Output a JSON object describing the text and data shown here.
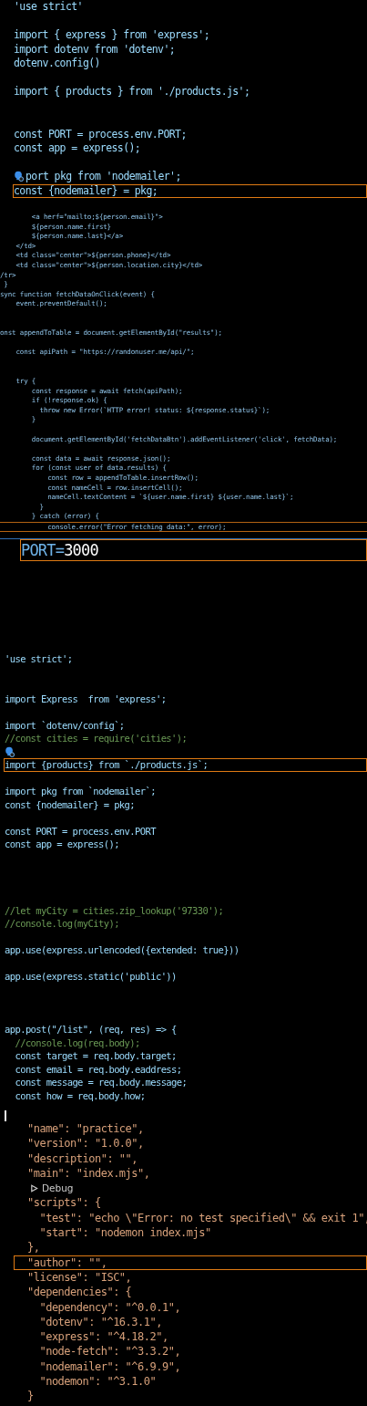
{
  "panels": [
    {
      "kind": "js",
      "lines": [
        {
          "text": "'use strict'",
          "kind": "code",
          "current": false
        },
        {
          "kind": "blank",
          "current": false
        },
        {
          "text": "import { express } from 'express';",
          "kind": "code",
          "current": false
        },
        {
          "text": "import dotenv from 'dotenv';",
          "kind": "code",
          "current": false
        },
        {
          "text": "dotenv.config()",
          "kind": "code",
          "current": false
        },
        {
          "kind": "blank",
          "current": false
        },
        {
          "text": "import { products } from './products.js';",
          "kind": "code",
          "current": false
        },
        {
          "kind": "blank",
          "current": false
        },
        {
          "kind": "blank",
          "current": false
        },
        {
          "text": "const PORT = process.env.PORT;",
          "kind": "code",
          "current": false
        },
        {
          "text": "const app = express();",
          "kind": "code",
          "current": false
        },
        {
          "kind": "blank",
          "current": false
        },
        {
          "text": "port pkg from 'nodemailer';",
          "kind": "hint",
          "current": false
        },
        {
          "text": "const {nodemailer} = pkg;",
          "kind": "code",
          "current": true
        }
      ]
    },
    {
      "kind": "js-small",
      "lines": [
        {
          "text": "        <a herf=\"mailto;${person.email}\">",
          "kind": "code",
          "current": false
        },
        {
          "text": "        ${person.name.first}",
          "kind": "code",
          "current": false
        },
        {
          "text": "        ${person.name.last}</a>",
          "kind": "code",
          "current": false
        },
        {
          "text": "    </td>",
          "kind": "code",
          "current": false
        },
        {
          "text": "    <td class=\"center\">${person.phone}</td>",
          "kind": "code",
          "current": false
        },
        {
          "text": "    <td class=\"center\">${person.location.city}</td>",
          "kind": "code",
          "current": false
        },
        {
          "text": "/tr>",
          "kind": "code",
          "current": false
        },
        {
          "text": " }",
          "kind": "code",
          "current": false
        },
        {
          "text": "sync function fetchDataOnClick(event) {",
          "kind": "code",
          "current": false
        },
        {
          "text": "    event.preventDefault();",
          "kind": "code",
          "current": false
        },
        {
          "kind": "blank",
          "current": false
        },
        {
          "kind": "blank",
          "current": false
        },
        {
          "text": "onst appendToTable = document.getElementById(\"results\");",
          "kind": "code",
          "current": false
        },
        {
          "kind": "blank",
          "current": false
        },
        {
          "text": "    const apiPath = \"https://randonuser.me/api/\";",
          "kind": "code",
          "current": false
        },
        {
          "kind": "blank",
          "current": false
        },
        {
          "kind": "blank",
          "current": false
        },
        {
          "text": "    try {",
          "kind": "code",
          "current": false
        },
        {
          "text": "        const response = await fetch(apiPath);",
          "kind": "code",
          "current": false
        },
        {
          "text": "        if (!response.ok) {",
          "kind": "code",
          "current": false
        },
        {
          "text": "          throw new Error(`HTTP error! status: ${response.status}`);",
          "kind": "code",
          "current": false
        },
        {
          "text": "        }",
          "kind": "code",
          "current": false
        },
        {
          "kind": "blank",
          "current": false
        },
        {
          "text": "        document.getElementById('fetchDataBtn').addEventListener('click', fetchData);",
          "kind": "code",
          "current": false
        },
        {
          "kind": "blank",
          "current": false
        },
        {
          "text": "        const data = await response.json();",
          "kind": "code",
          "current": false
        },
        {
          "text": "        for (const user of data.results) {",
          "kind": "code",
          "current": false
        },
        {
          "text": "            const row = appendToTable.insertRow();",
          "kind": "code",
          "current": false
        },
        {
          "text": "            const nameCell = row.insertCell();",
          "kind": "code",
          "current": false
        },
        {
          "text": "            nameCell.textContent = `${user.name.first} ${user.name.last}`;",
          "kind": "code",
          "current": false
        },
        {
          "text": "          }",
          "kind": "code",
          "current": false
        },
        {
          "text": "        } catch (error) {",
          "kind": "code",
          "current": false
        },
        {
          "text": "            console.error(\"Error fetching data:\", error);",
          "kind": "code",
          "current": true
        }
      ]
    },
    {
      "kind": "env",
      "name": "PORT",
      "sign": "=",
      "value": "3000",
      "current": true
    },
    {
      "kind": "js",
      "lines": [
        {
          "text": "'use strict';",
          "kind": "code",
          "current": false
        },
        {
          "kind": "blank",
          "current": false
        },
        {
          "kind": "blank",
          "current": false
        },
        {
          "text": "import Express  from 'express';",
          "kind": "code",
          "current": false
        },
        {
          "kind": "blank",
          "current": false
        },
        {
          "text": "import `dotenv/config`;",
          "kind": "code",
          "current": false
        },
        {
          "text": "//const cities = require('cities');",
          "kind": "comment",
          "current": false
        },
        {
          "kind": "hint",
          "current": false
        },
        {
          "text": "import {products} from `./products.js`;",
          "kind": "code",
          "current": true
        },
        {
          "kind": "blank",
          "current": false
        },
        {
          "text": "import pkg from `nodemailer`;",
          "kind": "code",
          "current": false
        },
        {
          "text": "const {nodemailer} = pkg;",
          "kind": "code",
          "current": false
        },
        {
          "kind": "blank",
          "current": false
        },
        {
          "text": "const PORT = process.env.PORT",
          "kind": "code",
          "current": false
        },
        {
          "text": "const app = express();",
          "kind": "code",
          "current": false
        },
        {
          "kind": "blank",
          "current": false
        },
        {
          "kind": "blank",
          "current": false
        },
        {
          "kind": "blank",
          "current": false
        },
        {
          "kind": "blank",
          "current": false
        },
        {
          "text": "//let myCity = cities.zip_lookup('97330');",
          "kind": "comment",
          "current": false
        },
        {
          "text": "//console.log(myCity);",
          "kind": "comment",
          "current": false
        },
        {
          "kind": "blank",
          "current": false
        },
        {
          "text": "app.use(express.urlencoded({extended: true}))",
          "kind": "code",
          "current": false
        },
        {
          "kind": "blank",
          "current": false
        },
        {
          "text": "app.use(express.static('public'))",
          "kind": "code",
          "current": false
        },
        {
          "kind": "blank",
          "current": false
        },
        {
          "kind": "blank",
          "current": false
        },
        {
          "kind": "blank",
          "current": false
        },
        {
          "text": "app.post(\"/list\", (req, res) => {",
          "kind": "code",
          "current": false
        },
        {
          "text": "  //console.log(req.body);",
          "kind": "comment",
          "current": false
        },
        {
          "text": "  const target = req.body.target;",
          "kind": "code",
          "current": false
        },
        {
          "text": "  const email = req.body.eaddress;",
          "kind": "code",
          "current": false
        },
        {
          "text": "  const message = req.body.message;",
          "kind": "code",
          "current": false
        },
        {
          "text": "  const how = req.body.how;",
          "kind": "code",
          "current": false
        }
      ]
    },
    {
      "kind": "json",
      "text_cursor": true,
      "lines": [
        {
          "text": "\"name\": \"practice\",",
          "kind": "code",
          "current": false
        },
        {
          "text": "\"version\": \"1.0.0\",",
          "kind": "code",
          "current": false
        },
        {
          "text": "\"description\": \"\",",
          "kind": "code",
          "current": false
        },
        {
          "text": "\"main\": \"index.mjs\",",
          "kind": "code",
          "current": false
        },
        {
          "text": "Debug",
          "kind": "codelens",
          "current": false
        },
        {
          "text": "\"scripts\": {",
          "kind": "code",
          "current": false
        },
        {
          "text": "  \"test\": \"echo \\\"Error: no test specified\\\" && exit 1\",",
          "kind": "code",
          "current": false
        },
        {
          "text": "  \"start\": \"nodemon index.mjs\"",
          "kind": "code",
          "current": false
        },
        {
          "text": "},",
          "kind": "code",
          "current": false
        },
        {
          "text": "\"author\": \"\",",
          "kind": "code",
          "current": true
        },
        {
          "text": "\"license\": \"ISC\",",
          "kind": "code",
          "current": false
        },
        {
          "text": "\"dependencies\": {",
          "kind": "code",
          "current": false
        },
        {
          "text": "  \"dependency\": \"^0.0.1\",",
          "kind": "code",
          "current": false
        },
        {
          "text": "  \"dotenv\": \"^16.3.1\",",
          "kind": "code",
          "current": false
        },
        {
          "text": "  \"express\": \"^4.18.2\",",
          "kind": "code",
          "current": false
        },
        {
          "text": "  \"node-fetch\": \"^3.3.2\",",
          "kind": "code",
          "current": false
        },
        {
          "text": "  \"nodemailer\": \"^6.9.9\",",
          "kind": "code",
          "current": false
        },
        {
          "text": "  \"nodemon\": \"^3.1.0\"",
          "kind": "code",
          "current": false
        },
        {
          "text": "}",
          "kind": "code",
          "current": false
        }
      ]
    }
  ]
}
